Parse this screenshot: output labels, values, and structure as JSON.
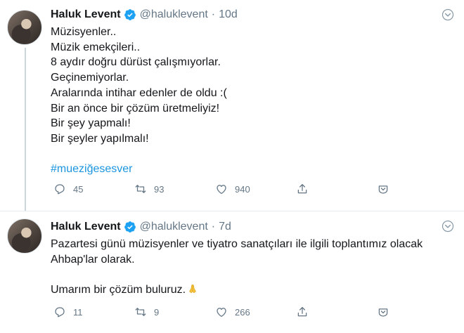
{
  "tweets": [
    {
      "user": {
        "name": "Haluk Levent",
        "handle": "@haluklevent"
      },
      "separator": "·",
      "time": "10d",
      "lines": [
        "Müzisyenler..",
        "Müzik emekçileri..",
        "8 aydır doğru dürüst çalışmıyorlar.",
        "Geçinemiyorlar.",
        "Aralarında intihar edenler de oldu :(",
        "Bir an önce bir çözüm üretmeliyiz!",
        "Bir şey yapmalı!",
        "Bir şeyler yapılmalı!",
        ""
      ],
      "hashtag": "#mueziğesesver",
      "stats": {
        "replies": "45",
        "retweets": "93",
        "likes": "940"
      }
    },
    {
      "user": {
        "name": "Haluk Levent",
        "handle": "@haluklevent"
      },
      "separator": "·",
      "time": "7d",
      "lines": [
        "Pazartesi günü müzisyenler ve tiyatro sanatçıları ile ilgili toplantımız olacak",
        "Ahbap'lar olarak.",
        "",
        "Umarım bir çözüm buluruz."
      ],
      "emoji": "folded-hands",
      "stats": {
        "replies": "11",
        "retweets": "9",
        "likes": "266"
      }
    }
  ],
  "icons": {
    "verified": "verified-badge-icon",
    "caret": "chevron-down-icon",
    "reply": "reply-bubble-icon",
    "retweet": "retweet-icon",
    "like": "heart-icon",
    "share": "share-upload-icon",
    "bookmark": "chevron-circle-icon"
  },
  "colors": {
    "accent": "#1da1f2",
    "hashtag": "#1b95e0",
    "muted": "#657786",
    "text": "#14171a",
    "divider": "#e6ecf0"
  }
}
